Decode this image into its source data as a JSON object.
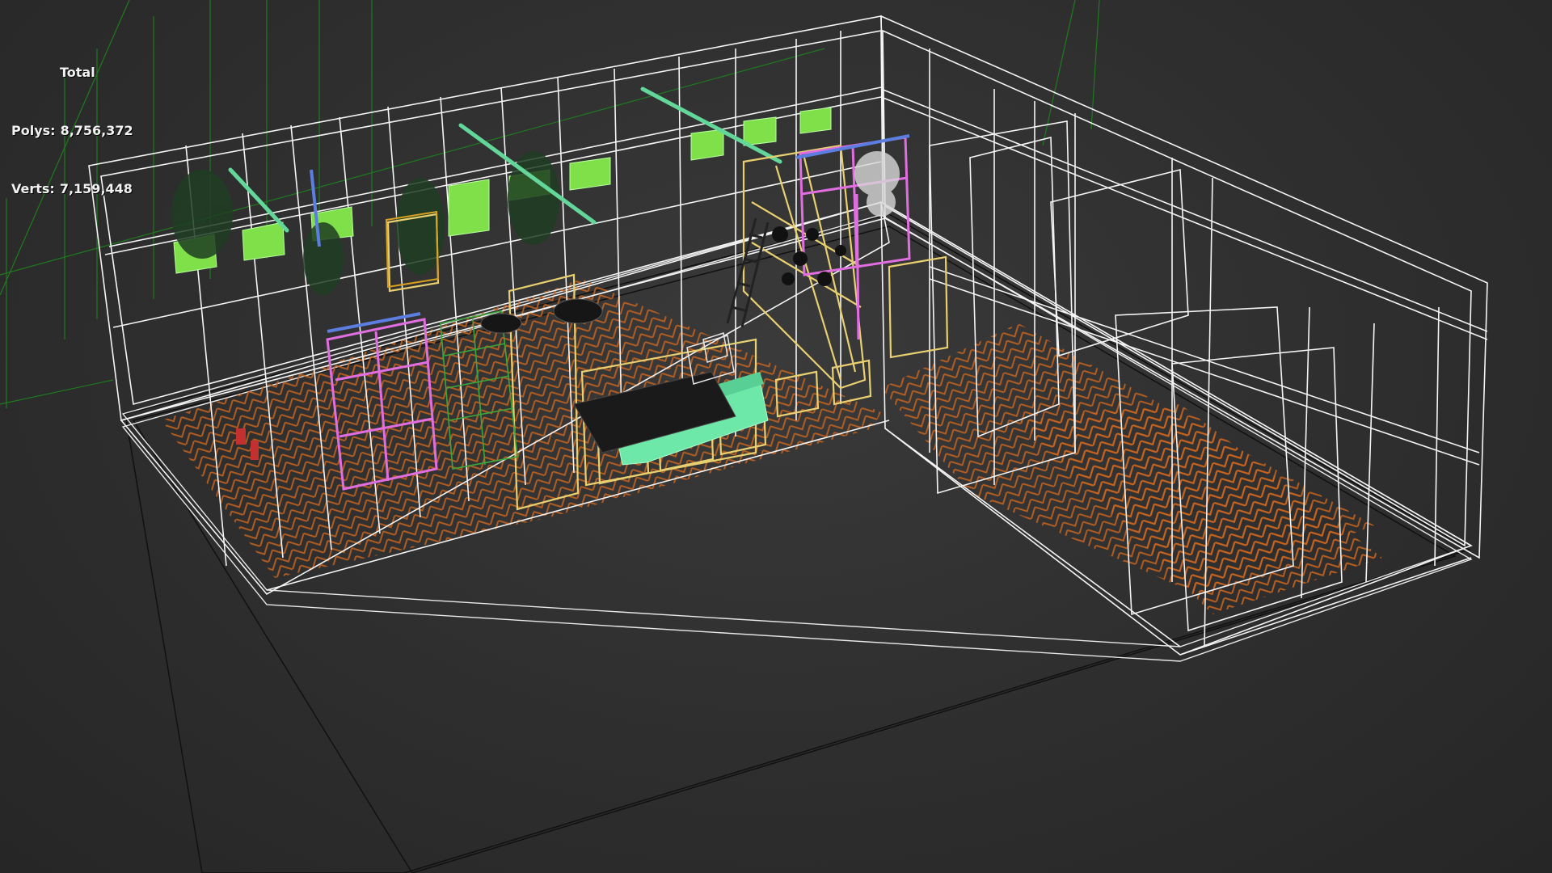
{
  "stats": {
    "title": "Total",
    "polys_label": "Polys:",
    "polys_value": "8,756,372",
    "verts_label": "Verts:",
    "verts_value": "7,159,448"
  },
  "colors": {
    "background": "#2e2e2e",
    "wireframe": "#ffffff",
    "grid_green": "#1f7a1f",
    "floor_orange": "#c8641e",
    "window_green": "#7fe04a",
    "frame_pink": "#e06ee0",
    "frame_yellow": "#e8d070",
    "sofa_mint": "#6de8a8",
    "rail_teal": "#63d69a",
    "frame_blue": "#5b7ee0"
  }
}
